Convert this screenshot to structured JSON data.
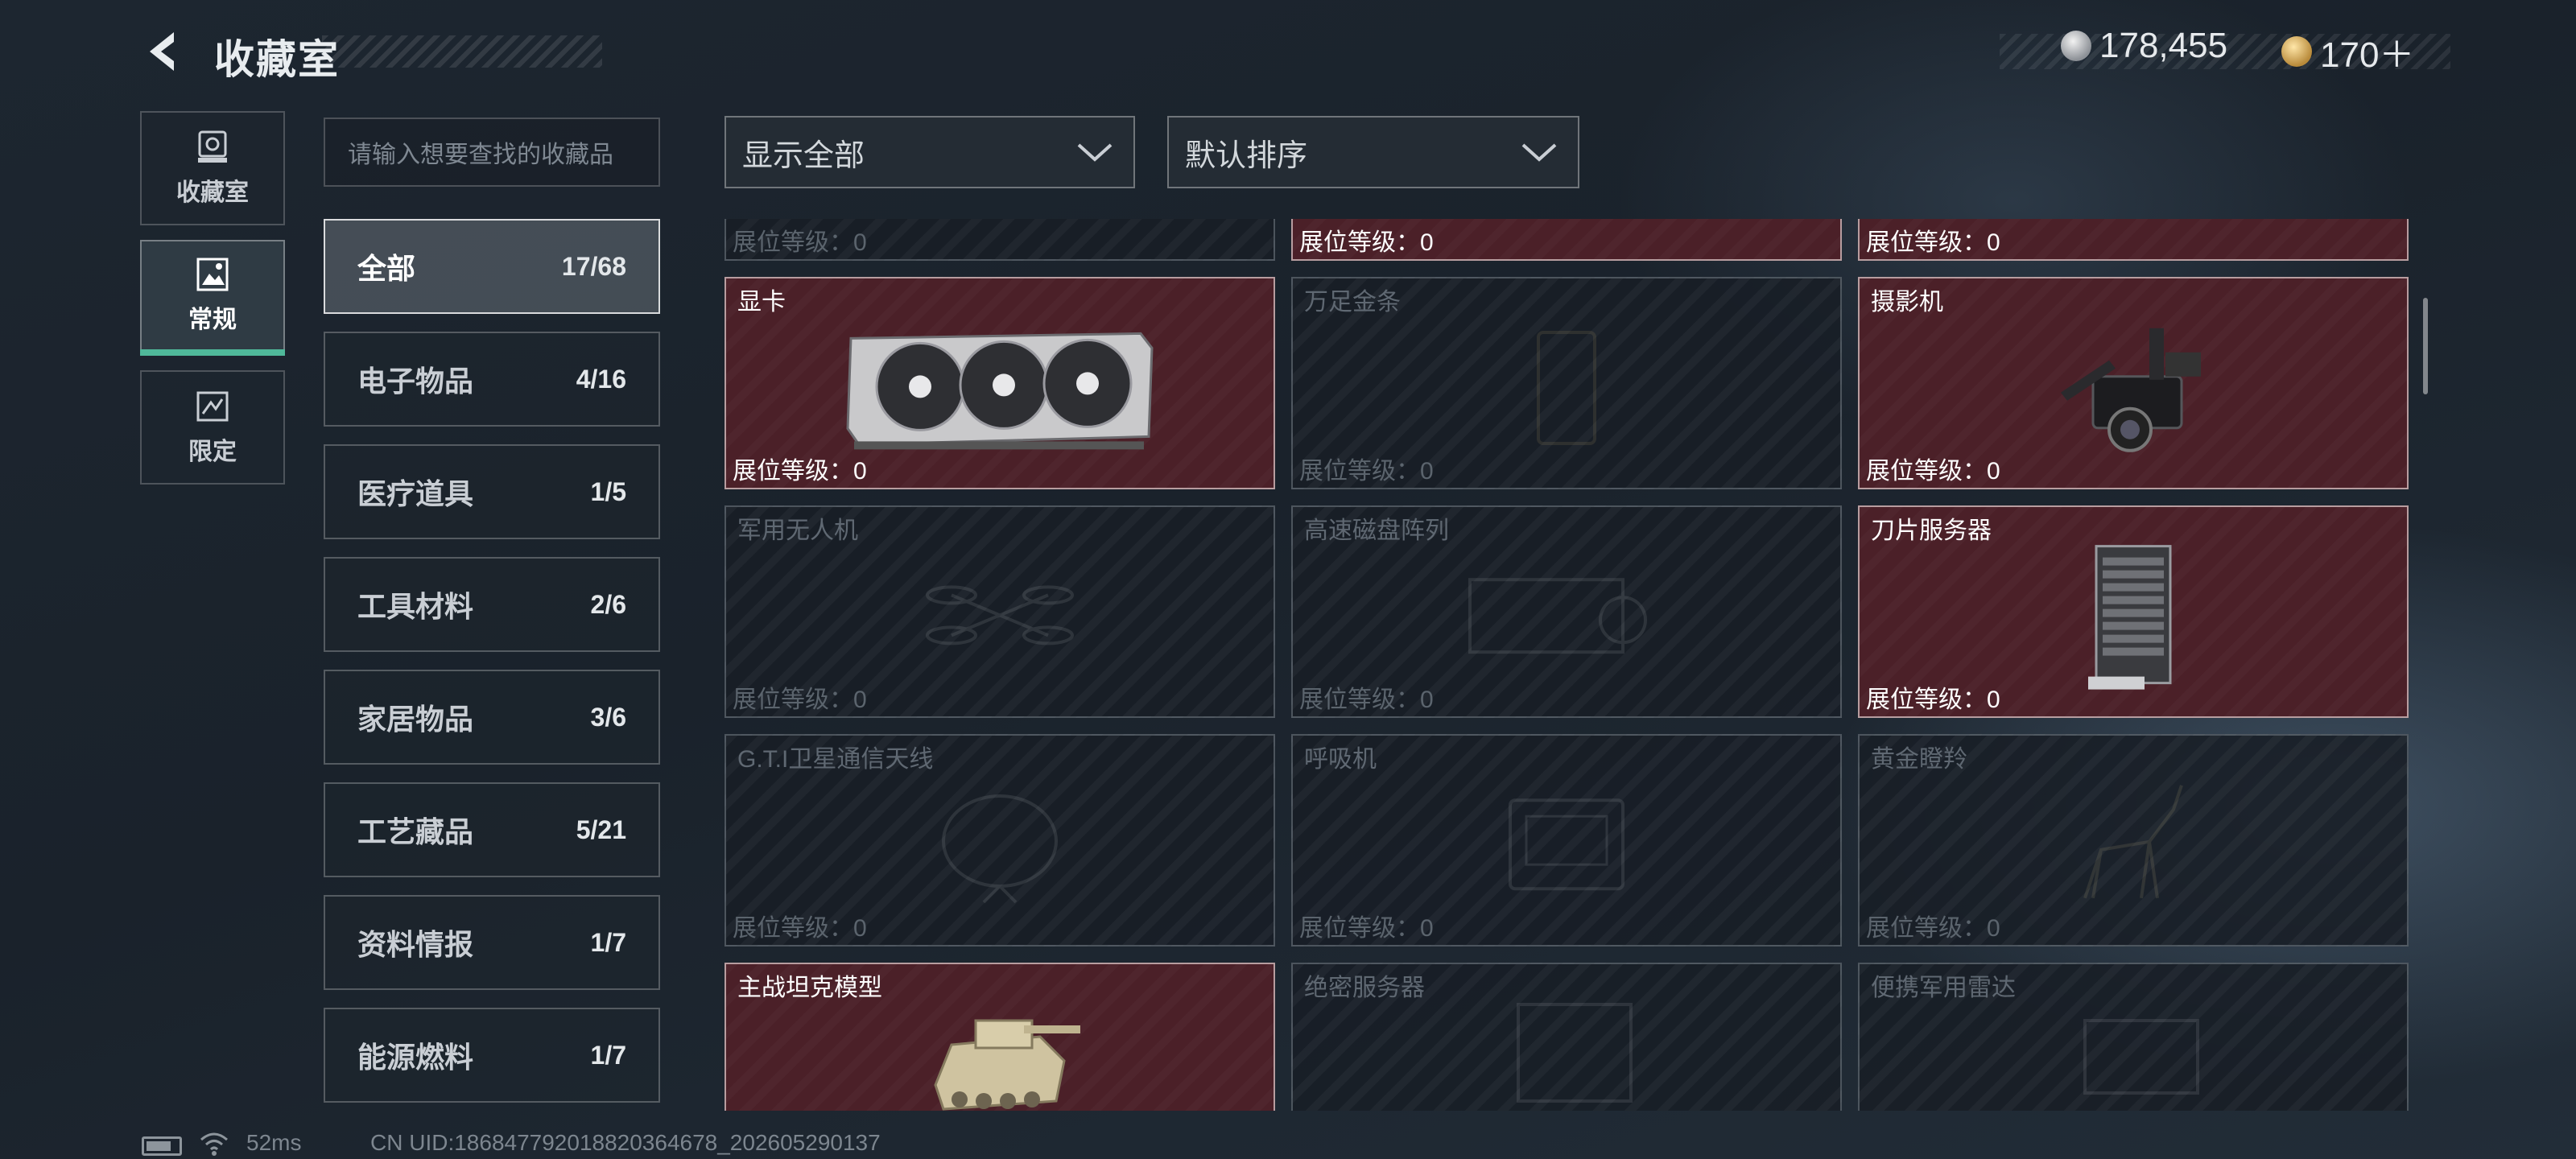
{
  "header": {
    "title": "收藏室"
  },
  "currency": [
    {
      "icon": "silver-coin-icon",
      "value": "178,455"
    },
    {
      "icon": "gold-coin-icon",
      "value": "170＋"
    }
  ],
  "tabs": [
    {
      "label": "收藏室",
      "icon": "collection-icon"
    },
    {
      "label": "常规",
      "icon": "photo-frame-icon",
      "active": true
    },
    {
      "label": "限定",
      "icon": "limited-icon"
    }
  ],
  "search": {
    "placeholder": "请输入想要查找的收藏品"
  },
  "categories": [
    {
      "name": "全部",
      "count": "17/68",
      "active": true
    },
    {
      "name": "电子物品",
      "count": "4/16"
    },
    {
      "name": "医疗道具",
      "count": "1/5"
    },
    {
      "name": "工具材料",
      "count": "2/6"
    },
    {
      "name": "家居物品",
      "count": "3/6"
    },
    {
      "name": "工艺藏品",
      "count": "5/21"
    },
    {
      "name": "资料情报",
      "count": "1/7"
    },
    {
      "name": "能源燃料",
      "count": "1/7"
    }
  ],
  "filters": {
    "show": "显示全部",
    "sort": "默认排序"
  },
  "level_label": "展位等级：0",
  "items": [
    {
      "name": "",
      "owned": false
    },
    {
      "name": "",
      "owned": true
    },
    {
      "name": "",
      "owned": true
    },
    {
      "name": "显卡",
      "owned": true,
      "icon": "graphics-card-icon"
    },
    {
      "name": "万足金条",
      "owned": false,
      "icon": "gold-bar-icon"
    },
    {
      "name": "摄影机",
      "owned": true,
      "icon": "video-camera-icon"
    },
    {
      "name": "军用无人机",
      "owned": false,
      "icon": "drone-icon"
    },
    {
      "name": "高速磁盘阵列",
      "owned": false,
      "icon": "disk-array-icon"
    },
    {
      "name": "刀片服务器",
      "owned": true,
      "icon": "blade-server-icon"
    },
    {
      "name": "G.T.I卫星通信天线",
      "owned": false,
      "icon": "satellite-dish-icon"
    },
    {
      "name": "呼吸机",
      "owned": false,
      "icon": "ventilator-icon"
    },
    {
      "name": "黄金瞪羚",
      "owned": false,
      "icon": "golden-gazelle-icon"
    },
    {
      "name": "主战坦克模型",
      "owned": true,
      "icon": "tank-model-icon"
    },
    {
      "name": "绝密服务器",
      "owned": false,
      "icon": "secret-server-icon"
    },
    {
      "name": "便携军用雷达",
      "owned": false,
      "icon": "portable-radar-icon"
    }
  ],
  "footer": {
    "ping": "52ms",
    "uid": "CN UID:1868477920188203646​78_202605290137"
  }
}
